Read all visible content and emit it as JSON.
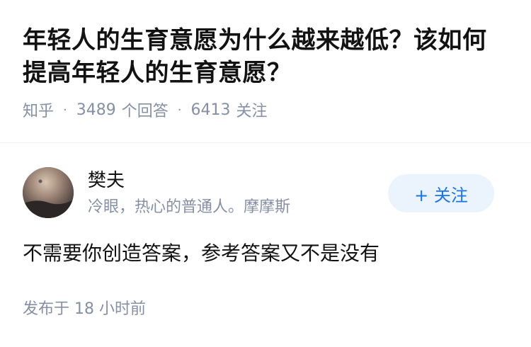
{
  "question": {
    "title": "年轻人的生育意愿为什么越来越低？该如何提高年轻人的生育意愿？",
    "site": "知乎",
    "answer_count": "3489",
    "answer_count_label": "个回答",
    "follower_count": "6413",
    "follower_count_label": "关注"
  },
  "author": {
    "name": "樊夫",
    "bio": "冷眼，热心的普通人。摩摩斯",
    "follow_label": "+ 关注"
  },
  "answer": {
    "content": "不需要你创造答案，参考答案又不是没有",
    "time": "发布于 18 小时前"
  },
  "colors": {
    "meta_gray": "#8590a6",
    "accent_blue": "#1772f6",
    "follow_bg": "#ebf3fd"
  }
}
